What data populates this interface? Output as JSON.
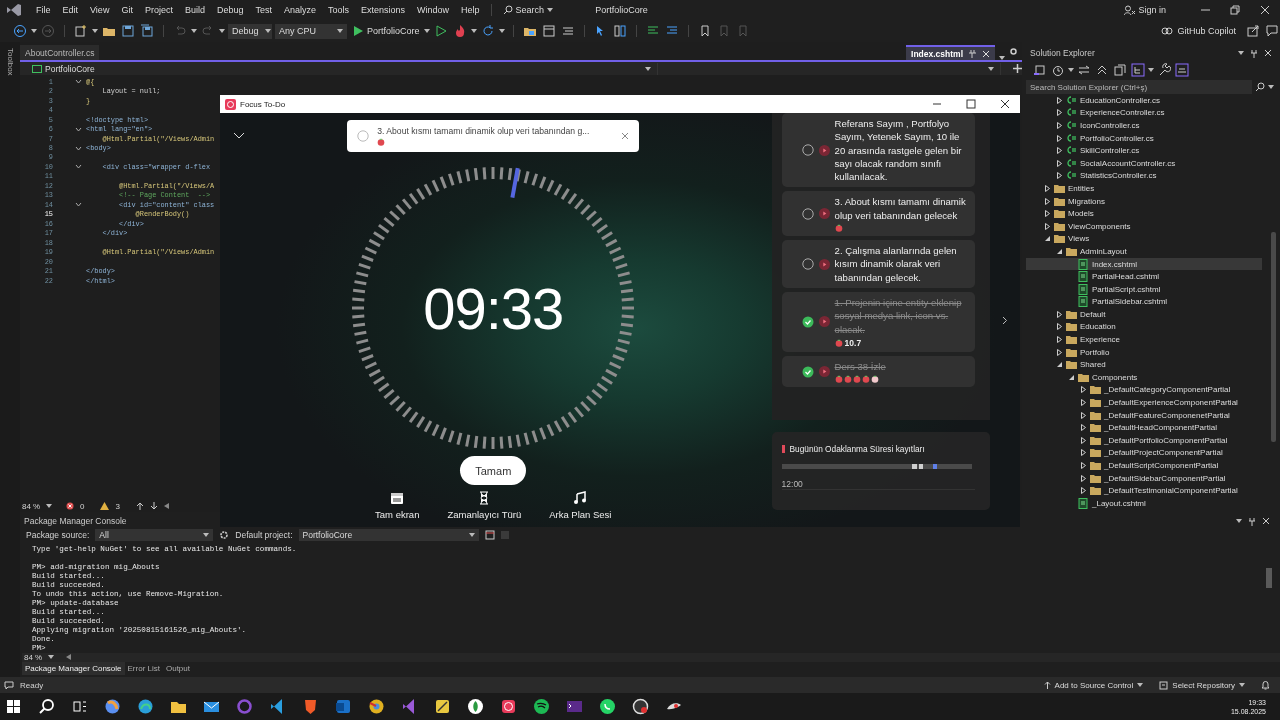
{
  "ide": {
    "menu": [
      "File",
      "Edit",
      "View",
      "Git",
      "Project",
      "Build",
      "Debug",
      "Test",
      "Analyze",
      "Tools",
      "Extensions",
      "Window",
      "Help"
    ],
    "search": "Search",
    "solution_name": "PortfolioCore",
    "sign_in": "Sign in",
    "toolbar": {
      "configuration": "Debug",
      "platform": "Any CPU",
      "run_target": "PortfolioCore",
      "copilot": "GitHub Copilot"
    }
  },
  "toolbox_label": "Toolbox",
  "editor": {
    "tabs": [
      {
        "label": "AboutController.cs",
        "selected": false
      },
      {
        "label": "Index.cshtml",
        "selected": true
      }
    ],
    "nav_project": "PortfolioCore",
    "lines": [
      {
        "num": "1",
        "text": "@{",
        "kind": "razor",
        "fold": true,
        "current": false
      },
      {
        "num": "2",
        "text": "    Layout = null;",
        "kind": "code",
        "fold": false,
        "current": false
      },
      {
        "num": "3",
        "text": "}",
        "kind": "razor",
        "fold": false,
        "current": false
      },
      {
        "num": "4",
        "fold": false,
        "current": false
      },
      {
        "num": "5",
        "text": "<!doctype html>",
        "kind": "tag",
        "fold": false,
        "current": false
      },
      {
        "num": "6",
        "text": "<html lang=\"en\">",
        "kind": "tag",
        "fold": true,
        "current": false
      },
      {
        "num": "7",
        "text": "    @Html.Partial(\"/Views/Admin",
        "kind": "razor",
        "fold": false,
        "current": false
      },
      {
        "num": "8",
        "text": "<body>",
        "kind": "tag",
        "fold": true,
        "current": false
      },
      {
        "num": "9",
        "fold": false,
        "current": false
      },
      {
        "num": "10",
        "text": "    <div class=\"wrapper d-flex",
        "kind": "tag",
        "fold": true,
        "current": false
      },
      {
        "num": "11",
        "fold": false,
        "current": false
      },
      {
        "num": "12",
        "text": "        @Html.Partial(\"/Views/A",
        "kind": "razor",
        "fold": false,
        "current": false
      },
      {
        "num": "13",
        "text": "        <!-- Page Content  -->",
        "kind": "comment",
        "fold": false,
        "current": false
      },
      {
        "num": "14",
        "text": "        <div id=\"content\" class",
        "kind": "tag",
        "fold": true,
        "current": false
      },
      {
        "num": "15",
        "text": "            @RenderBody()",
        "kind": "razor",
        "fold": false,
        "current": true
      },
      {
        "num": "16",
        "text": "        </div>",
        "kind": "tag",
        "fold": false,
        "current": false
      },
      {
        "num": "17",
        "text": "    </div>",
        "kind": "tag",
        "fold": false,
        "current": false
      },
      {
        "num": "18",
        "fold": false,
        "current": false
      },
      {
        "num": "19",
        "text": "    @Html.Partial(\"/Views/Admin",
        "kind": "razor",
        "fold": false,
        "current": false
      },
      {
        "num": "20",
        "fold": false,
        "current": false
      },
      {
        "num": "21",
        "text": "</body>",
        "kind": "tag",
        "fold": false,
        "current": false
      },
      {
        "num": "22",
        "text": "</html>",
        "kind": "tag",
        "fold": false,
        "current": false
      }
    ],
    "zoom": "84 %",
    "errors": "0",
    "warnings": "3"
  },
  "solution_explorer": {
    "title": "Solution Explorer",
    "search": {
      "placeholder": "Search Solution Explorer (Ctrl+ş)"
    },
    "tree_continued": [
      {
        "label": "EducationController.cs",
        "kind": "cs",
        "expanded": false,
        "selected": false
      },
      {
        "label": "ExperienceController.cs",
        "kind": "cs",
        "expanded": false,
        "selected": false
      },
      {
        "label": "IconController.cs",
        "kind": "cs",
        "expanded": false,
        "selected": false
      },
      {
        "label": "PortfolioController.cs",
        "kind": "cs",
        "expanded": false,
        "selected": false
      },
      {
        "label": "SkillController.cs",
        "kind": "cs",
        "expanded": false,
        "selected": false
      },
      {
        "label": "SocialAccountController.cs",
        "kind": "cs",
        "expanded": false,
        "selected": false
      },
      {
        "label": "StatisticsController.cs",
        "kind": "cs",
        "expanded": false,
        "selected": false
      }
    ],
    "tree": [
      {
        "label": "Entities",
        "kind": "folder",
        "expanded": false,
        "selected": false
      },
      {
        "label": "Migrations",
        "kind": "folder",
        "expanded": false,
        "selected": false
      },
      {
        "label": "Models",
        "kind": "folder",
        "expanded": false,
        "selected": false
      },
      {
        "label": "ViewComponents",
        "kind": "folder",
        "expanded": false,
        "selected": false
      },
      {
        "label": "Views",
        "kind": "folder",
        "expanded": true,
        "selected": false,
        "children": [
          {
            "label": "AdminLayout",
            "kind": "folder",
            "expanded": true,
            "selected": false,
            "children": [
              {
                "label": "Index.cshtml",
                "kind": "cshtml",
                "selected": true
              },
              {
                "label": "PartialHead.cshtml",
                "kind": "cshtml",
                "selected": false
              },
              {
                "label": "PartialScript.cshtml",
                "kind": "cshtml",
                "selected": false
              },
              {
                "label": "PartialSidebar.cshtml",
                "kind": "cshtml",
                "selected": false
              }
            ]
          },
          {
            "label": "Default",
            "kind": "folder",
            "expanded": false,
            "selected": false
          },
          {
            "label": "Education",
            "kind": "folder",
            "expanded": false,
            "selected": false
          },
          {
            "label": "Experience",
            "kind": "folder",
            "expanded": false,
            "selected": false
          },
          {
            "label": "Portfolio",
            "kind": "folder",
            "expanded": false,
            "selected": false
          },
          {
            "label": "Shared",
            "kind": "folder",
            "expanded": true,
            "selected": false,
            "children": [
              {
                "label": "Components",
                "kind": "folder",
                "expanded": true,
                "selected": false,
                "children": [
                  {
                    "label": "_DefaultCategoryComponentPartial",
                    "kind": "folder",
                    "expanded": false,
                    "selected": false
                  },
                  {
                    "label": "_DefaultExperienceComponentPartial",
                    "kind": "folder",
                    "expanded": false,
                    "selected": false
                  },
                  {
                    "label": "_DefaultFeatureComponenetPartial",
                    "kind": "folder",
                    "expanded": false,
                    "selected": false
                  },
                  {
                    "label": "_DefaultHeadComponentPartial",
                    "kind": "folder",
                    "expanded": false,
                    "selected": false
                  },
                  {
                    "label": "_DefaultPortfolioComponentPartial",
                    "kind": "folder",
                    "expanded": false,
                    "selected": false
                  },
                  {
                    "label": "_DefaultProjectComponentPartial",
                    "kind": "folder",
                    "expanded": false,
                    "selected": false
                  },
                  {
                    "label": "_DefaultScriptComponentPartial",
                    "kind": "folder",
                    "expanded": false,
                    "selected": false
                  },
                  {
                    "label": "_DefaultSidebarComponentPartial",
                    "kind": "folder",
                    "expanded": false,
                    "selected": false
                  },
                  {
                    "label": "_DefaultTestimonialComponentPartial",
                    "kind": "folder",
                    "expanded": false,
                    "selected": false
                  }
                ]
              },
              {
                "label": "_Layout.cshtml",
                "kind": "cshtml",
                "selected": false
              }
            ]
          }
        ]
      }
    ]
  },
  "console": {
    "title": "Package Manager Console",
    "source_label": "Package source:",
    "source": "All",
    "project_label": "Default project:",
    "project": "PortfolioCore",
    "lines": [
      {
        "kind": "text",
        "text": "Type 'get-help NuGet' to see all available NuGet commands."
      },
      {
        "kind": "blank"
      },
      {
        "kind": "text",
        "text": "PM> add-migration mig_Abouts"
      },
      {
        "kind": "text",
        "text": "Build started..."
      },
      {
        "kind": "text",
        "text": "Build succeeded."
      },
      {
        "kind": "text",
        "text": "To undo this action, use Remove-Migration."
      },
      {
        "kind": "text",
        "text": "PM> update-database"
      },
      {
        "kind": "text",
        "text": "Build started..."
      },
      {
        "kind": "text",
        "text": "Build succeeded."
      },
      {
        "kind": "text",
        "text": "Applying migration '20250815161526_mig_Abouts'."
      },
      {
        "kind": "text",
        "text": "Done."
      },
      {
        "kind": "text",
        "text": "PM>"
      }
    ],
    "zoom": "84 %",
    "tabs": [
      {
        "label": "Package Manager Console",
        "selected": true
      },
      {
        "label": "Error List",
        "selected": false
      },
      {
        "label": "Output",
        "selected": false
      }
    ]
  },
  "status_bar": {
    "text": "Ready",
    "source_control": "Add to Source Control",
    "repository": "Select Repository"
  },
  "taskbar": {
    "time": "19:33",
    "date": "15.08.2025"
  },
  "focus_window": {
    "title": "Focus To-Do",
    "banner": {
      "text": "3. About kısmı tamamı dinamik olup veri tabanından g...",
      "checked": false,
      "tomato": true
    },
    "timer": "09:33",
    "confirm": "Tamam",
    "actions": [
      {
        "kind": "fullscreen",
        "label": "Tam ekran"
      },
      {
        "kind": "timer_type",
        "label": "Zamanlayıcı Türü"
      },
      {
        "kind": "sound",
        "label": "Arka Plan Sesi"
      }
    ],
    "tasks": [
      {
        "text": "Referans Sayım , Portfolyo Sayım, Yetenek Sayım, 10 ile 20 arasında rastgele gelen bir sayı olacak random sınıfı kullanılacak.",
        "done": false,
        "tomato": false
      },
      {
        "text": "3. About kısmı tamamı dinamik olup veri tabanından gelecek",
        "done": false,
        "tomato": true
      },
      {
        "text": "2. Çalışma alanlarında gelen kısım dinamik olarak veri tabanından gelecek.",
        "done": false,
        "tomato": false
      },
      {
        "text": "1. Projenin içine entity eklenip sosyal medya link, icon vs. olacak.",
        "done": true,
        "tomato": true,
        "reading": "10.7"
      },
      {
        "text": "Ders 38 İzle",
        "done": true,
        "tomato": false,
        "stars": 4
      }
    ],
    "records": {
      "title": "Bugünün Odaklanma Süresi kayıtları",
      "time": "12:00"
    }
  }
}
